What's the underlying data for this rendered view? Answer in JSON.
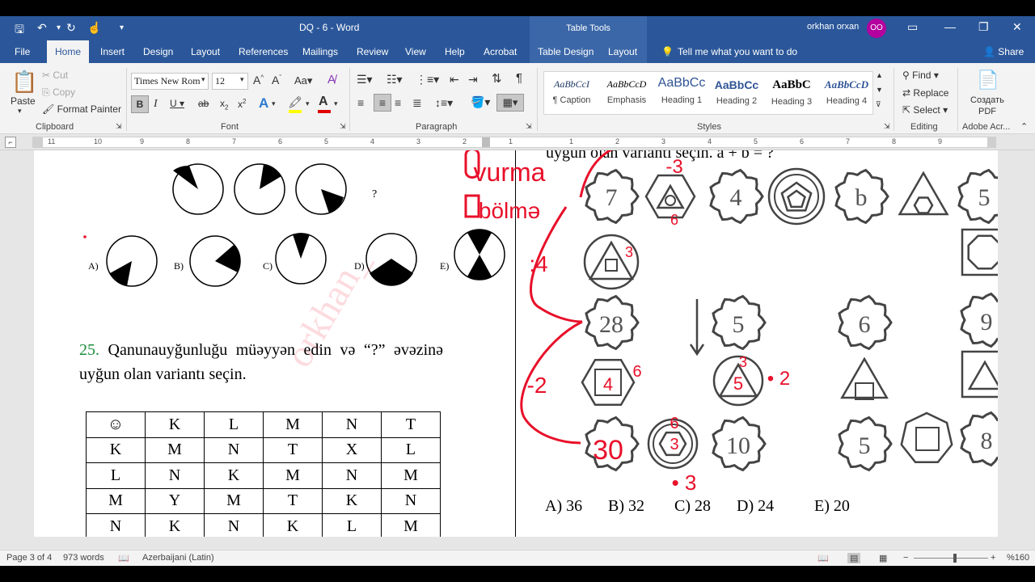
{
  "window": {
    "doc_title": "DQ - 6  -  Word",
    "context_tab_header": "Table Tools",
    "user_name": "orkhan orxan",
    "user_initials": "OO"
  },
  "tabs": [
    "File",
    "Home",
    "Insert",
    "Design",
    "Layout",
    "References",
    "Mailings",
    "Review",
    "View",
    "Help",
    "Acrobat",
    "Table Design",
    "Layout"
  ],
  "tell_me": "Tell me what you want to do",
  "share": "Share",
  "clipboard": {
    "paste": "Paste",
    "cut": "Cut",
    "copy": "Copy",
    "format_painter": "Format Painter",
    "label": "Clipboard"
  },
  "font": {
    "name": "Times New Rom",
    "size": "12",
    "label": "Font",
    "change_case": "Aa"
  },
  "paragraph": {
    "label": "Paragraph"
  },
  "styles": {
    "label": "Styles",
    "items": [
      {
        "sample": "AaBbCcI",
        "name": "¶ Caption"
      },
      {
        "sample": "AaBbCcD",
        "name": "Emphasis"
      },
      {
        "sample": "AaBbCc",
        "name": "Heading 1"
      },
      {
        "sample": "AaBbCc",
        "name": "Heading 2"
      },
      {
        "sample": "AaBbC",
        "name": "Heading 3"
      },
      {
        "sample": "AaBbCcD",
        "name": "Heading 4"
      }
    ]
  },
  "editing": {
    "find": "Find",
    "replace": "Replace",
    "select": "Select",
    "label": "Editing"
  },
  "adobe": {
    "create": "Создать",
    "pdf": "PDF",
    "label": "Adobe Acr..."
  },
  "ruler_numbers": [
    "11",
    "10",
    "9",
    "8",
    "7",
    "6",
    "5",
    "4",
    "3",
    "2",
    "1",
    "1",
    "2",
    "3",
    "4",
    "5",
    "6",
    "7",
    "8",
    "9"
  ],
  "document": {
    "options_left": [
      "A)",
      "B)",
      "C)",
      "D)",
      "E)"
    ],
    "question_mark": "?",
    "q25_number": "25.",
    "q25_text": "Qanunauyğunluğu müəyyən edin və “?” əvəzinə uyğun olan variantı seçin.",
    "table": [
      [
        "☺",
        "K",
        "L",
        "M",
        "N",
        "T"
      ],
      [
        "K",
        "M",
        "N",
        "T",
        "X",
        "L"
      ],
      [
        "L",
        "N",
        "K",
        "M",
        "N",
        "M"
      ],
      [
        "M",
        "Y",
        "M",
        "T",
        "K",
        "N"
      ],
      [
        "N",
        "K",
        "N",
        "K",
        "L",
        "M"
      ]
    ],
    "right_top_text": "uyğun olan variantı seçin. a + b = ?",
    "shape_numbers": [
      "7",
      "4",
      "b",
      "5",
      "28",
      "5",
      "6",
      "9",
      "4",
      "5",
      "10",
      "5",
      "8",
      "30"
    ],
    "answers": [
      "A) 36",
      "B) 32",
      "C) 28",
      "D) 24",
      "E) 20"
    ],
    "handwriting": [
      "vurma",
      "bölmə",
      "-3",
      "6",
      ":4",
      "3",
      "-2",
      "6",
      "3",
      "• 2",
      "6",
      "3",
      "• 3"
    ],
    "watermark": "orkhan_"
  },
  "status": {
    "page": "Page 3 of 4",
    "words": "973 words",
    "language": "Azerbaijani (Latin)",
    "zoom": "%160"
  },
  "colors": {
    "word_blue": "#2b579a",
    "ink_red": "#e8102a",
    "q_number_green": "#1a8f3c"
  }
}
